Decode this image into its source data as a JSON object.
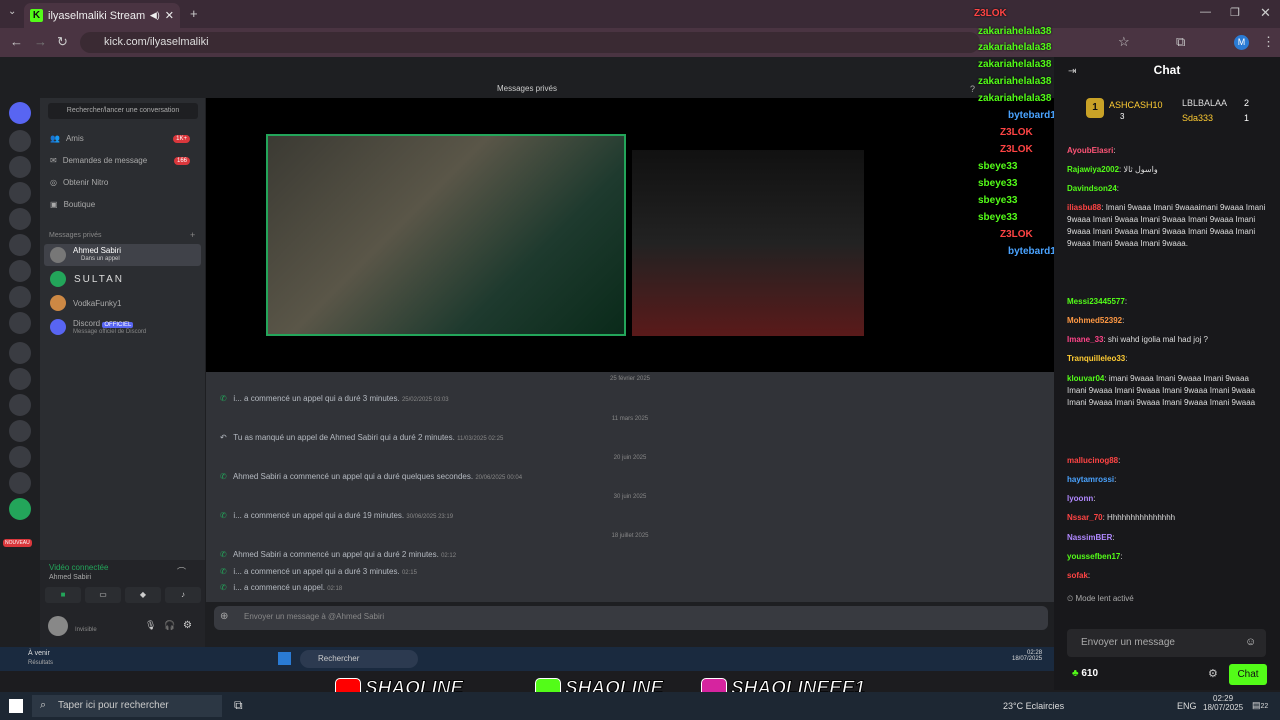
{
  "browser": {
    "tab_title": "ilyaselmaliki Stream - Watc",
    "url": "kick.com/ilyaselmaliki",
    "profile_initial": "M"
  },
  "discord": {
    "topbar_title": "Messages privés",
    "search_label": "Rechercher/lancer une conversation",
    "nav": [
      {
        "label": "Amis",
        "badge": "1K+"
      },
      {
        "label": "Demandes de message",
        "badge": "166"
      },
      {
        "label": "Obtenir Nitro",
        "badge": ""
      },
      {
        "label": "Boutique",
        "badge": ""
      }
    ],
    "dm_header": "Messages privés",
    "dms": [
      {
        "name": "Ahmed Sabiri",
        "sub": "Dans un appel"
      },
      {
        "name": "SULTAN",
        "sub": ""
      },
      {
        "name": "VodkaFunky1",
        "sub": ""
      },
      {
        "name": "Discord",
        "sub": "Message officiel de Discord",
        "tag": "OFFICIEL"
      }
    ],
    "server_badges": [
      "1K+",
      "",
      "1",
      "86",
      "",
      "80",
      "29",
      "",
      "40",
      "",
      "",
      "16",
      "72",
      "",
      "64",
      "61",
      "96",
      "",
      "NOUVEAU"
    ],
    "voice_status": "Vidéo connectée",
    "voice_user": "Ahmed Sabiri",
    "self_status": "Invisible",
    "messages": [
      {
        "date": "25 février 2025",
        "text": "i... a commencé un appel qui a duré 3 minutes.",
        "ts": "25/02/2025 03:03"
      },
      {
        "date": "11 mars 2025",
        "text": "Tu as manqué un appel de Ahmed Sabiri qui a duré 2 minutes.",
        "ts": "11/03/2025 02:25"
      },
      {
        "date": "20 juin 2025",
        "text": "Ahmed Sabiri a commencé un appel qui a duré quelques secondes.",
        "ts": "20/06/2025 00:04"
      },
      {
        "date": "30 juin 2025",
        "text": "i... a commencé un appel qui a duré 19 minutes.",
        "ts": "30/06/2025 23:19"
      },
      {
        "date": "18 juillet 2025",
        "text": "Ahmed Sabiri a commencé un appel qui a duré 2 minutes.",
        "ts": "02:12"
      },
      {
        "date": "",
        "text": "i... a commencé un appel qui a duré 3 minutes.",
        "ts": "02:15"
      },
      {
        "date": "",
        "text": "i... a commencé un appel.",
        "ts": "02:18"
      }
    ],
    "input_placeholder": "Envoyer un message à @Ahmed Sabiri"
  },
  "inner_taskbar": {
    "weather": "À venir",
    "weather_sub": "Résultats",
    "search": "Rechercher",
    "time": "02:28",
    "date": "18/07/2025"
  },
  "overlay_chat": [
    {
      "user": "Z3LOK",
      "color": "#ff4444"
    },
    {
      "user": "zakariahelala38",
      "color": "#53fc18"
    },
    {
      "user": "zakariahelala38",
      "color": "#53fc18"
    },
    {
      "user": "zakariahelala38",
      "color": "#53fc18"
    },
    {
      "user": "zakariahelala38",
      "color": "#53fc18"
    },
    {
      "user": "zakariahelala38",
      "color": "#53fc18"
    },
    {
      "user": "bytebard1",
      "color": "#4aa3ff"
    },
    {
      "user": "Z3LOK",
      "color": "#ff4444"
    },
    {
      "user": "Z3LOK",
      "color": "#ff4444"
    },
    {
      "user": "sbeye33",
      "color": "#53fc18"
    },
    {
      "user": "sbeye33",
      "color": "#53fc18"
    },
    {
      "user": "sbeye33",
      "color": "#53fc18"
    },
    {
      "user": "sbeye33",
      "color": "#53fc18"
    },
    {
      "user": "Z3LOK",
      "color": "#ff4444"
    },
    {
      "user": "bytebard1",
      "color": "#4aa3ff"
    }
  ],
  "kick": {
    "title": "Chat",
    "leaders": [
      {
        "name": "ASHCASH10",
        "count": "3",
        "rank": "1"
      },
      {
        "name": "LBLBALAA",
        "count": "2"
      },
      {
        "name": "Sda333",
        "count": "1"
      }
    ],
    "messages": [
      {
        "user": "AyoubElasri",
        "color": "#ff5577",
        "text": ""
      },
      {
        "user": "Rajawiya2002",
        "color": "#53fc18",
        "text": "واسول ثالا"
      },
      {
        "user": "Davindson24",
        "color": "#53fc18",
        "text": ""
      },
      {
        "user": "iliasbu88",
        "color": "#ff4444",
        "text": "Imani 9waaa Imani 9waaaimani 9waaa Imani 9waaa Imani 9waaa Imani 9waaa Imani 9waaa Imani 9waaa Imani 9waaa Imani 9waaa Imani 9waaa Imani 9waaa Imani 9waaa Imani 9waaa."
      },
      {
        "user": "Messi23445577",
        "color": "#53fc18",
        "text": ""
      },
      {
        "user": "Mohmed52392",
        "color": "#ff9944",
        "text": ""
      },
      {
        "user": "Imane_33",
        "color": "#ff4488",
        "text": "shi wahd igolia mal had joj ?"
      },
      {
        "user": "Tranquilleleo33",
        "color": "#ffcc33",
        "text": ""
      },
      {
        "user": "klouvar04",
        "color": "#53fc18",
        "text": "imani 9waaa Imani 9waaa Imani 9waaa Imani 9waaa Imani 9waaa Imani 9waaa Imani 9waaa Imani 9waaa Imani 9waaa Imani 9waaa Imani 9waaa"
      },
      {
        "user": "mallucinog88",
        "color": "#ff4444",
        "text": ""
      },
      {
        "user": "haytamrossi",
        "color": "#4aa3ff",
        "text": ""
      },
      {
        "user": "lyoonn",
        "color": "#b088ff",
        "text": ""
      },
      {
        "user": "Nssar_70",
        "color": "#ff4444",
        "text": "Hhhhhhhhhhhhhhh"
      },
      {
        "user": "NassimBER",
        "color": "#b088ff",
        "text": ""
      },
      {
        "user": "youssefben17",
        "color": "#53fc18",
        "text": ""
      },
      {
        "user": "sofak",
        "color": "#ff4444",
        "text": ""
      }
    ],
    "slow_mode": "Mode lent activé",
    "input_placeholder": "Envoyer un message",
    "points": "610",
    "send_label": "Chat"
  },
  "banner": {
    "youtube": "SHAOLINE",
    "kick": "SHAOLINE",
    "instagram": "SHAOLINEEE1"
  },
  "taskbar": {
    "search": "Taper ici pour rechercher",
    "weather": "23°C  Eclaircies",
    "lang": "ENG",
    "time": "02:29",
    "date": "18/07/2025",
    "notif": "22"
  }
}
